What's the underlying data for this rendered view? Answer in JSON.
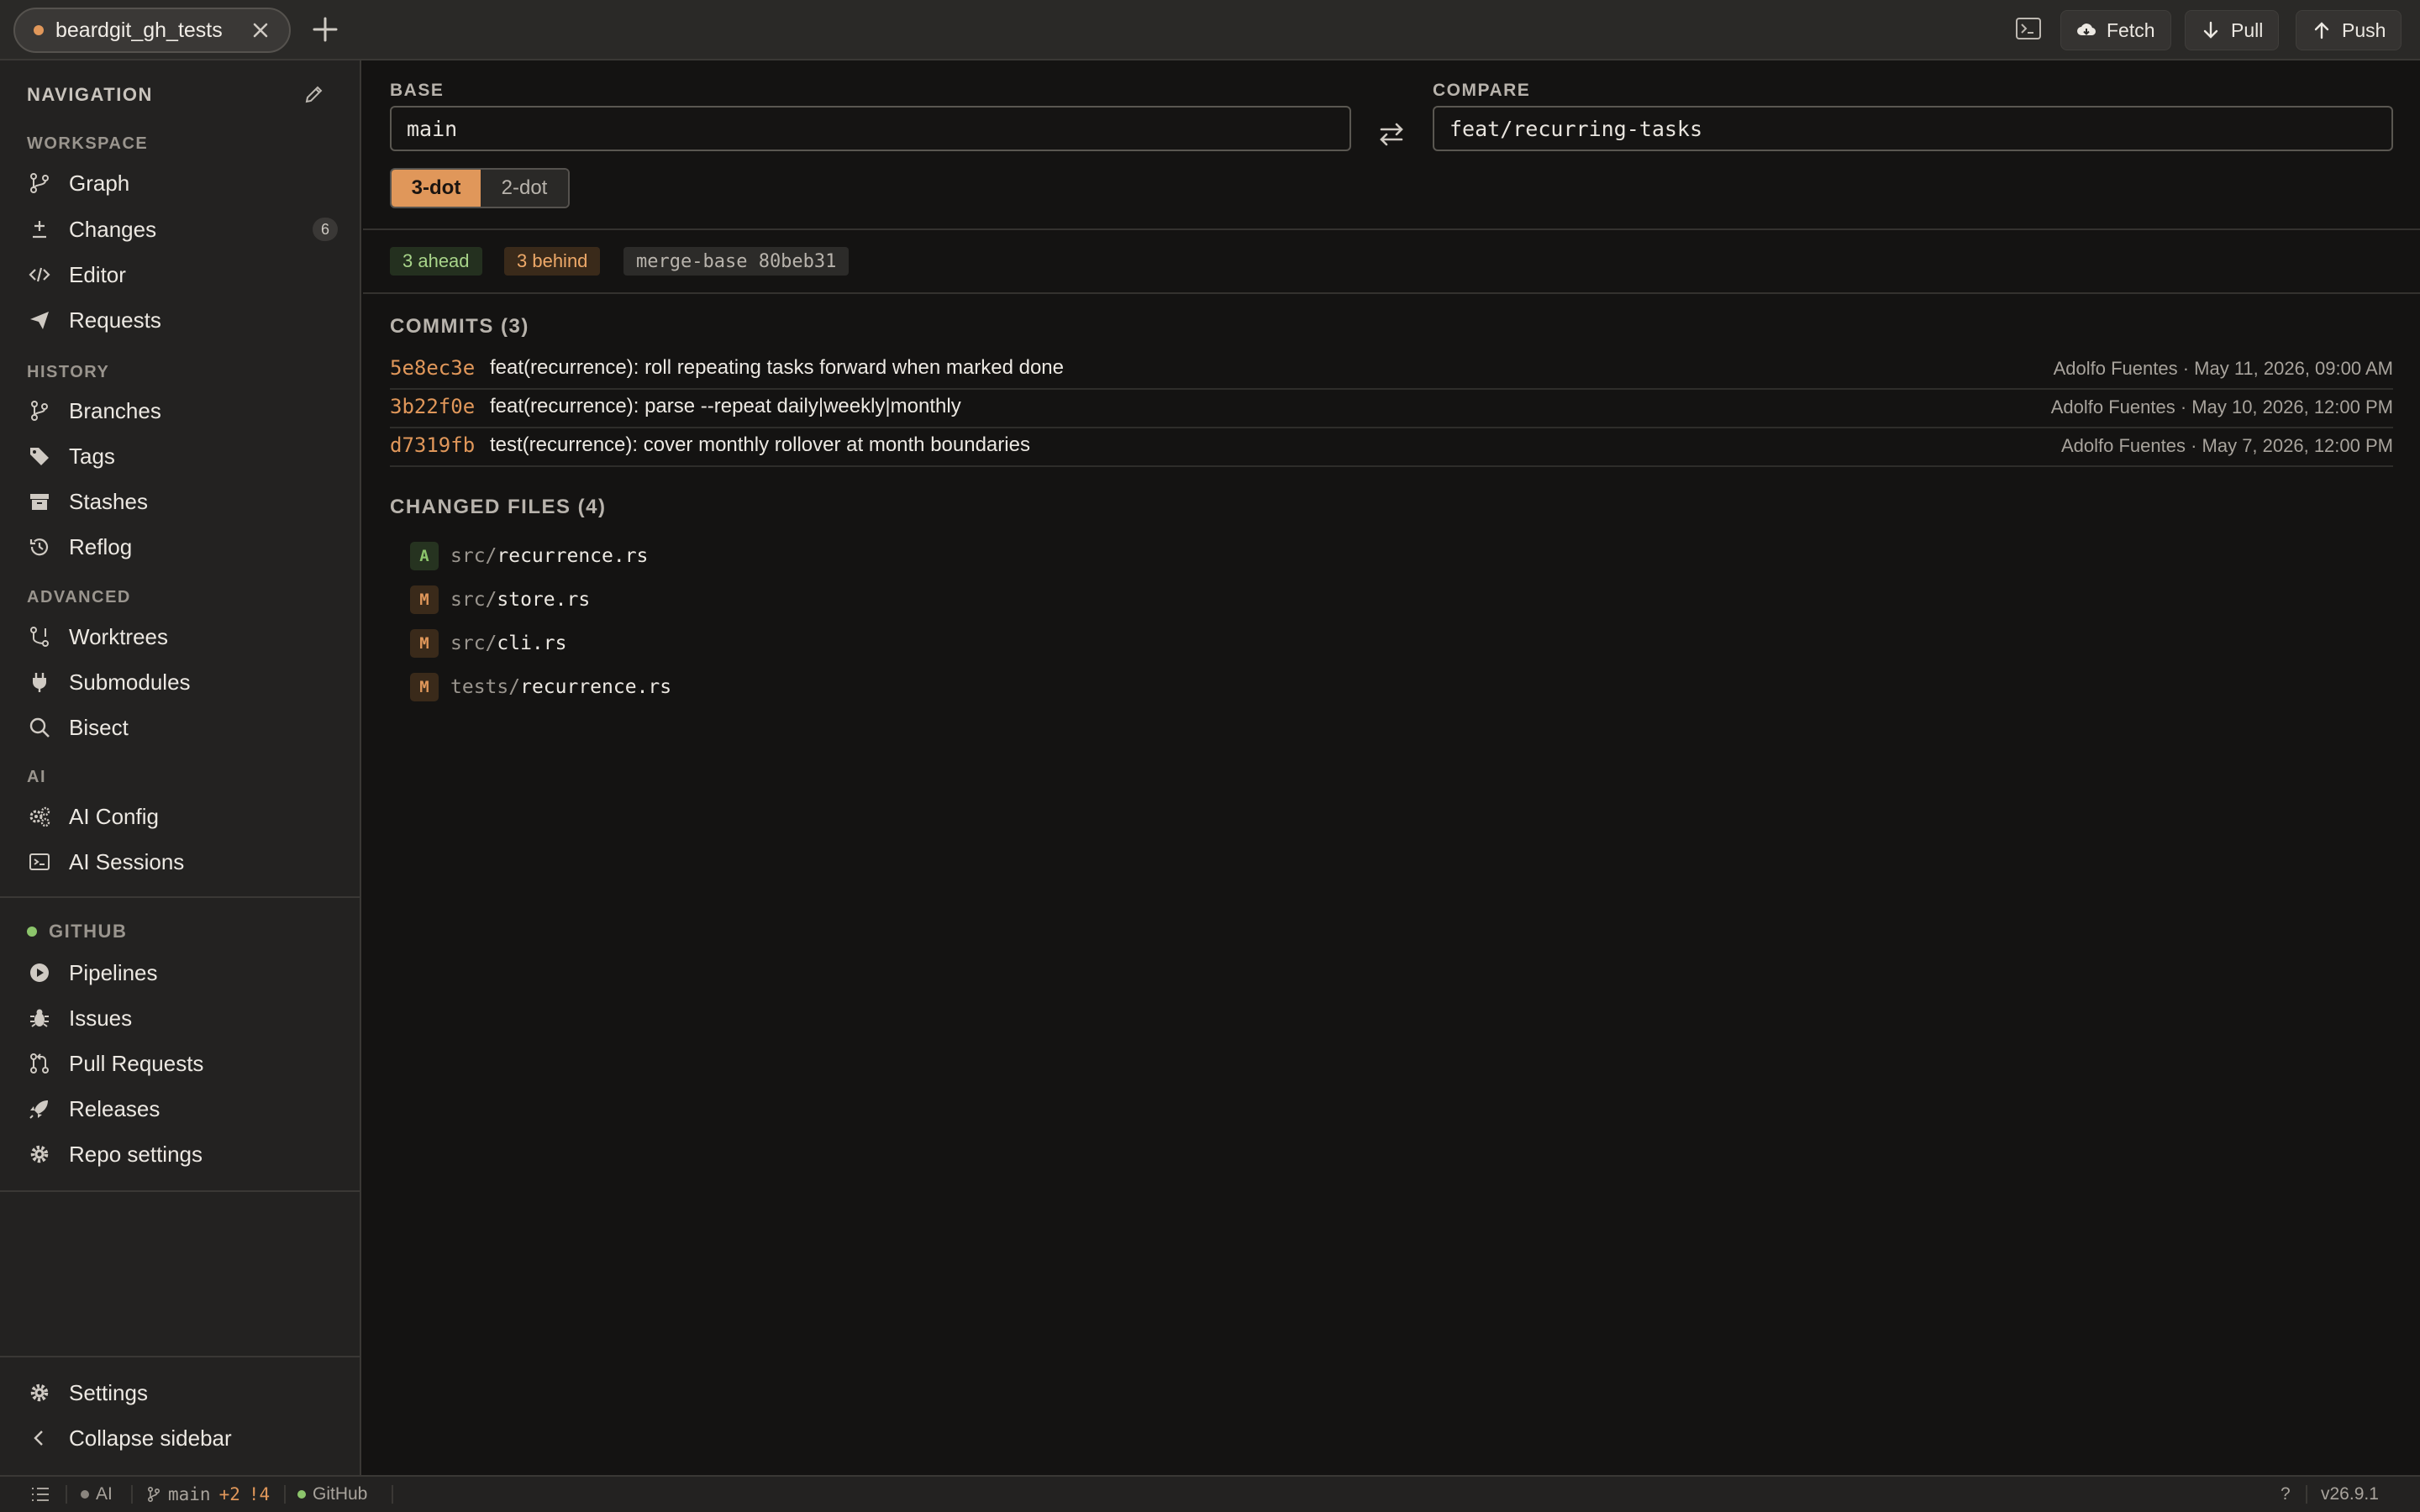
{
  "topbar": {
    "tab_title": "beardgit_gh_tests",
    "fetch_label": "Fetch",
    "pull_label": "Pull",
    "push_label": "Push"
  },
  "sidebar": {
    "heading": "NAVIGATION",
    "sections": {
      "workspace": "WORKSPACE",
      "history": "HISTORY",
      "advanced": "ADVANCED",
      "ai": "AI",
      "github": "GITHUB"
    },
    "items": {
      "graph": "Graph",
      "changes": "Changes",
      "changes_count": "6",
      "editor": "Editor",
      "requests": "Requests",
      "branches": "Branches",
      "tags": "Tags",
      "stashes": "Stashes",
      "reflog": "Reflog",
      "worktrees": "Worktrees",
      "submodules": "Submodules",
      "bisect": "Bisect",
      "ai_config": "AI Config",
      "ai_sessions": "AI Sessions",
      "pipelines": "Pipelines",
      "issues": "Issues",
      "pull_requests": "Pull Requests",
      "releases": "Releases",
      "repo_settings": "Repo settings",
      "settings": "Settings",
      "collapse": "Collapse sidebar"
    }
  },
  "compare": {
    "base_label": "BASE",
    "base_value": "main",
    "compare_label": "COMPARE",
    "compare_value": "feat/recurring-tasks",
    "mode_3dot": "3-dot",
    "mode_2dot": "2-dot",
    "ahead": "3 ahead",
    "behind": "3 behind",
    "merge_base": "merge-base 80beb31"
  },
  "commits": {
    "title": "COMMITS (3)",
    "items": [
      {
        "sha": "5e8ec3e",
        "message": "feat(recurrence): roll repeating tasks forward when marked done",
        "meta": "Adolfo Fuentes · May 11, 2026, 09:00 AM"
      },
      {
        "sha": "3b22f0e",
        "message": "feat(recurrence): parse --repeat daily|weekly|monthly",
        "meta": "Adolfo Fuentes · May 10, 2026, 12:00 PM"
      },
      {
        "sha": "d7319fb",
        "message": "test(recurrence): cover monthly rollover at month boundaries",
        "meta": "Adolfo Fuentes · May 7, 2026, 12:00 PM"
      }
    ]
  },
  "files": {
    "title": "CHANGED FILES (4)",
    "items": [
      {
        "status": "A",
        "dir": "src/",
        "name": "recurrence.rs"
      },
      {
        "status": "M",
        "dir": "src/",
        "name": "store.rs"
      },
      {
        "status": "M",
        "dir": "src/",
        "name": "cli.rs"
      },
      {
        "status": "M",
        "dir": "tests/",
        "name": "recurrence.rs"
      }
    ]
  },
  "statusbar": {
    "ai": "AI",
    "branch": "main",
    "added": "+2",
    "modified": "!4",
    "github": "GitHub",
    "help": "?",
    "version": "v26.9.1"
  },
  "colors": {
    "accent": "#e0975a",
    "success": "#8cc56b",
    "background": "#141312",
    "sidebar": "#232221"
  }
}
